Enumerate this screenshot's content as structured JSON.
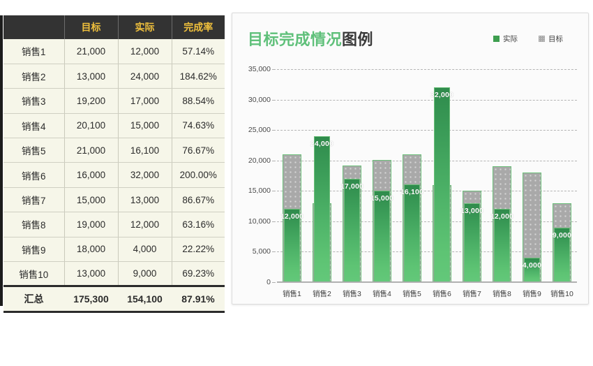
{
  "table": {
    "headers": [
      "",
      "目标",
      "实际",
      "完成率"
    ],
    "rows": [
      {
        "name": "销售1",
        "target": "21,000",
        "actual": "12,000",
        "rate": "57.14%"
      },
      {
        "name": "销售2",
        "target": "13,000",
        "actual": "24,000",
        "rate": "184.62%"
      },
      {
        "name": "销售3",
        "target": "19,200",
        "actual": "17,000",
        "rate": "88.54%"
      },
      {
        "name": "销售4",
        "target": "20,100",
        "actual": "15,000",
        "rate": "74.63%"
      },
      {
        "name": "销售5",
        "target": "21,000",
        "actual": "16,100",
        "rate": "76.67%"
      },
      {
        "name": "销售6",
        "target": "16,000",
        "actual": "32,000",
        "rate": "200.00%"
      },
      {
        "name": "销售7",
        "target": "15,000",
        "actual": "13,000",
        "rate": "86.67%"
      },
      {
        "name": "销售8",
        "target": "19,000",
        "actual": "12,000",
        "rate": "63.16%"
      },
      {
        "name": "销售9",
        "target": "18,000",
        "actual": "4,000",
        "rate": "22.22%"
      },
      {
        "name": "销售10",
        "target": "13,000",
        "actual": "9,000",
        "rate": "69.23%"
      }
    ],
    "total": {
      "name": "汇总",
      "target": "175,300",
      "actual": "154,100",
      "rate": "87.91%"
    }
  },
  "chart": {
    "title_green": "目标完成情况",
    "title_dark": "图例",
    "legend": [
      {
        "label": "实际",
        "swatch": "actual",
        "color": "#3d9e4f"
      },
      {
        "label": "目标",
        "swatch": "target",
        "color": "#a9a9a9"
      }
    ]
  },
  "chart_data": {
    "type": "bar",
    "title": "目标完成情况图例",
    "xlabel": "",
    "ylabel": "",
    "ylim": [
      0,
      35000
    ],
    "ytick_step": 5000,
    "ytick_labels": [
      "0",
      "5,000",
      "10,000",
      "15,000",
      "20,000",
      "25,000",
      "30,000",
      "35,000"
    ],
    "ytick_values": [
      0,
      5000,
      10000,
      15000,
      20000,
      25000,
      30000,
      35000
    ],
    "grid": true,
    "legend_position": "top-right",
    "overlap": true,
    "categories": [
      "销售1",
      "销售2",
      "销售3",
      "销售4",
      "销售5",
      "销售6",
      "销售7",
      "销售8",
      "销售9",
      "销售10"
    ],
    "series": [
      {
        "name": "目标",
        "color": "#a9a9a9",
        "values": [
          21000,
          13000,
          19200,
          20100,
          21000,
          16000,
          15000,
          19000,
          18000,
          13000
        ],
        "labels_shown": false
      },
      {
        "name": "实际",
        "color": "#3d9e4f",
        "values": [
          12000,
          24000,
          17000,
          15000,
          16100,
          32000,
          13000,
          12000,
          4000,
          9000
        ],
        "labels_shown": true,
        "data_labels": [
          "12,000",
          "24,000",
          "17,000",
          "15,000",
          "16,100",
          "32,000",
          "13,000",
          "12,000",
          "4,000",
          "9,000"
        ]
      }
    ]
  }
}
